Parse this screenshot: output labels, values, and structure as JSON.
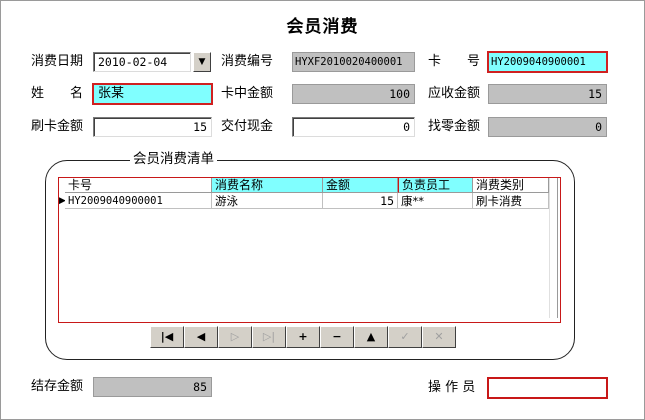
{
  "form": {
    "title": "会员消费",
    "date_label": "消费日期",
    "date_value": "2010-02-04",
    "consume_no_label": "消费编号",
    "consume_no_value": "HYXF2010020400001",
    "card_no_label": "卡　　号",
    "card_no_value": "HY2009040900001",
    "name_label": "姓　　名",
    "name_value": "张某",
    "card_balance_label": "卡中金额",
    "card_balance_value": "100",
    "receivable_label": "应收金额",
    "receivable_value": "15",
    "card_pay_label": "刷卡金额",
    "card_pay_value": "15",
    "cash_label": "交付现金",
    "cash_value": "0",
    "change_label": "找零金额",
    "change_value": "0",
    "remaining_label": "结存金额",
    "remaining_value": "85",
    "operator_label": "操 作 员",
    "operator_value": ""
  },
  "list": {
    "title": "会员消费清单",
    "columns": [
      "卡号",
      "消费名称",
      "金额",
      "负责员工",
      "消费类别"
    ],
    "rows": [
      [
        "HY2009040900001",
        "游泳",
        "15",
        "康**",
        "刷卡消费"
      ]
    ]
  },
  "navigator": {
    "buttons": [
      "|◀",
      "◀",
      "▷",
      "▷|",
      "+",
      "−",
      "▲",
      "✓",
      "✕"
    ]
  },
  "icons": {
    "dropdown": "chevron-down-icon",
    "row_indicator": "row-pointer-icon"
  },
  "colors": {
    "highlight": "#80ffff",
    "focus_border": "#c81818",
    "readonly": "#c0c0c0"
  }
}
